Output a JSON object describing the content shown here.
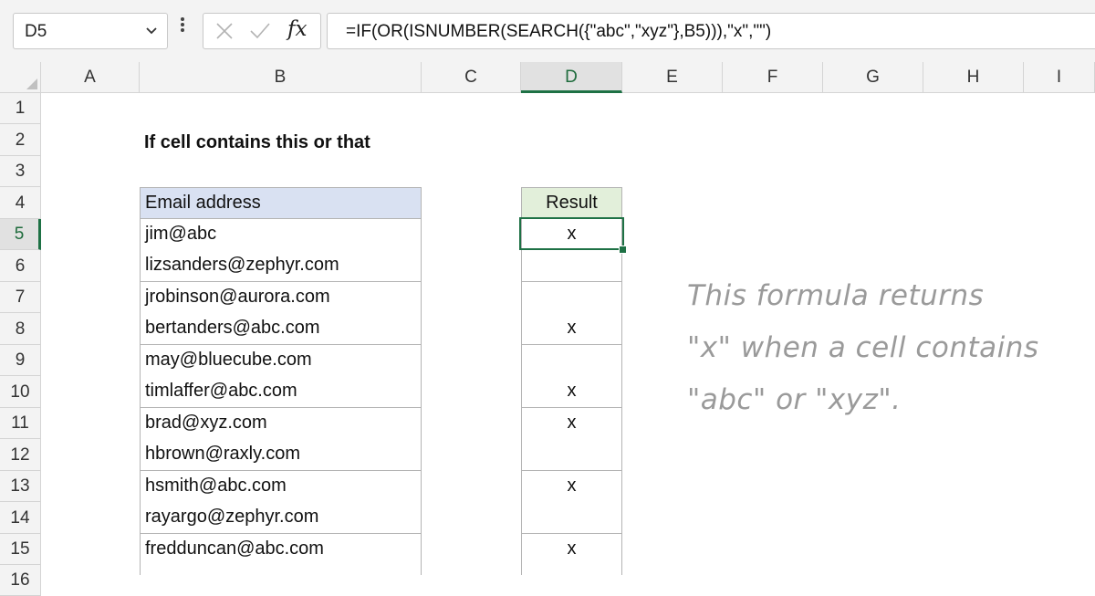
{
  "name_box": {
    "value": "D5"
  },
  "formula_bar": {
    "formula": "=IF(OR(ISNUMBER(SEARCH({\"abc\",\"xyz\"},B5))),\"x\",\"\")",
    "fx_label": "fx"
  },
  "columns": [
    "A",
    "B",
    "C",
    "D",
    "E",
    "F",
    "G",
    "H",
    "I"
  ],
  "rows": [
    "1",
    "2",
    "3",
    "4",
    "5",
    "6",
    "7",
    "8",
    "9",
    "10",
    "11",
    "12",
    "13",
    "14",
    "15",
    "16"
  ],
  "active_cell": {
    "column": "D",
    "row": "5"
  },
  "sheet": {
    "title": "If cell contains this or that",
    "email_header": "Email address",
    "result_header": "Result",
    "emails": [
      "jim@abc",
      "lizsanders@zephyr.com",
      "jrobinson@aurora.com",
      "bertanders@abc.com",
      "may@bluecube.com",
      "timlaffer@abc.com",
      "brad@xyz.com",
      "hbrown@raxly.com",
      "hsmith@abc.com",
      "rayargo@zephyr.com",
      "fredduncan@abc.com"
    ],
    "results": [
      "x",
      "",
      "",
      "x",
      "",
      "x",
      "x",
      "",
      "x",
      "",
      "x"
    ]
  },
  "note": {
    "lines": [
      "This formula returns",
      "\"x\" when a cell contains",
      "\"abc\" or \"xyz\"."
    ]
  }
}
